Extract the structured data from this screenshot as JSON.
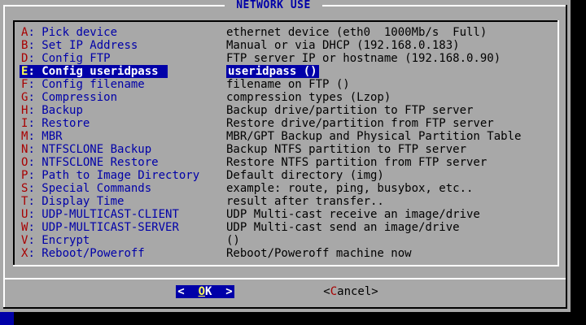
{
  "dialog": {
    "title": "NETWORK USE"
  },
  "menu": {
    "items": [
      {
        "key": "A",
        "rest": ": Pick device",
        "desc": "ethernet device (eth0  1000Mb/s  Full)"
      },
      {
        "key": "B",
        "rest": ": Set IP Address",
        "desc": "Manual or via DHCP (192.168.0.183)"
      },
      {
        "key": "D",
        "rest": ": Config FTP",
        "desc": "FTP server IP or hostname (192.168.0.90)"
      },
      {
        "key": "E",
        "rest": ": Config useridpass",
        "desc": "useridpass ()",
        "selected": true
      },
      {
        "key": "F",
        "rest": ": Config filename",
        "desc": "filename on FTP ()"
      },
      {
        "key": "G",
        "rest": ": Compression",
        "desc": "compression types (Lzop)"
      },
      {
        "key": "H",
        "rest": ": Backup",
        "desc": "Backup drive/partition to FTP server"
      },
      {
        "key": "I",
        "rest": ": Restore",
        "desc": "Restore drive/partition from FTP server"
      },
      {
        "key": "M",
        "rest": ": MBR",
        "desc": "MBR/GPT Backup and Physical Partition Table"
      },
      {
        "key": "N",
        "rest": ": NTFSCLONE Backup",
        "desc": "Backup NTFS partition to FTP server"
      },
      {
        "key": "O",
        "rest": ": NTFSCLONE Restore",
        "desc": "Restore NTFS partition from FTP server"
      },
      {
        "key": "P",
        "rest": ": Path to Image Directory",
        "desc": "Default directory (img)"
      },
      {
        "key": "S",
        "rest": ": Special Commands",
        "desc": "example: route, ping, busybox, etc.."
      },
      {
        "key": "T",
        "rest": ": Display Time",
        "desc": "result after transfer.."
      },
      {
        "key": "U",
        "rest": ": UDP-MULTICAST-CLIENT",
        "desc": "UDP Multi-cast receive an image/drive"
      },
      {
        "key": "W",
        "rest": ": UDP-MULTICAST-SERVER",
        "desc": "UDP Multi-cast send an image/drive"
      },
      {
        "key": "V",
        "rest": ": Encrypt",
        "desc": "()"
      },
      {
        "key": "X",
        "rest": ": Reboot/Poweroff",
        "desc": "Reboot/Poweroff machine now"
      }
    ]
  },
  "buttons": {
    "ok": {
      "open": "<  ",
      "accel": "O",
      "rest": "K",
      "close": "  >"
    },
    "cancel": {
      "open": "<",
      "accel": "C",
      "rest": "ancel",
      "close": ">"
    }
  },
  "colors": {
    "screen_bg": "#000000",
    "dialog_bg": "#a8a8a8",
    "tag_text": "#0000a8",
    "hotkey_text": "#a80000",
    "selected_bg": "#0000a8",
    "selected_text": "#ffffff",
    "selected_hotkey": "#ffff54"
  }
}
